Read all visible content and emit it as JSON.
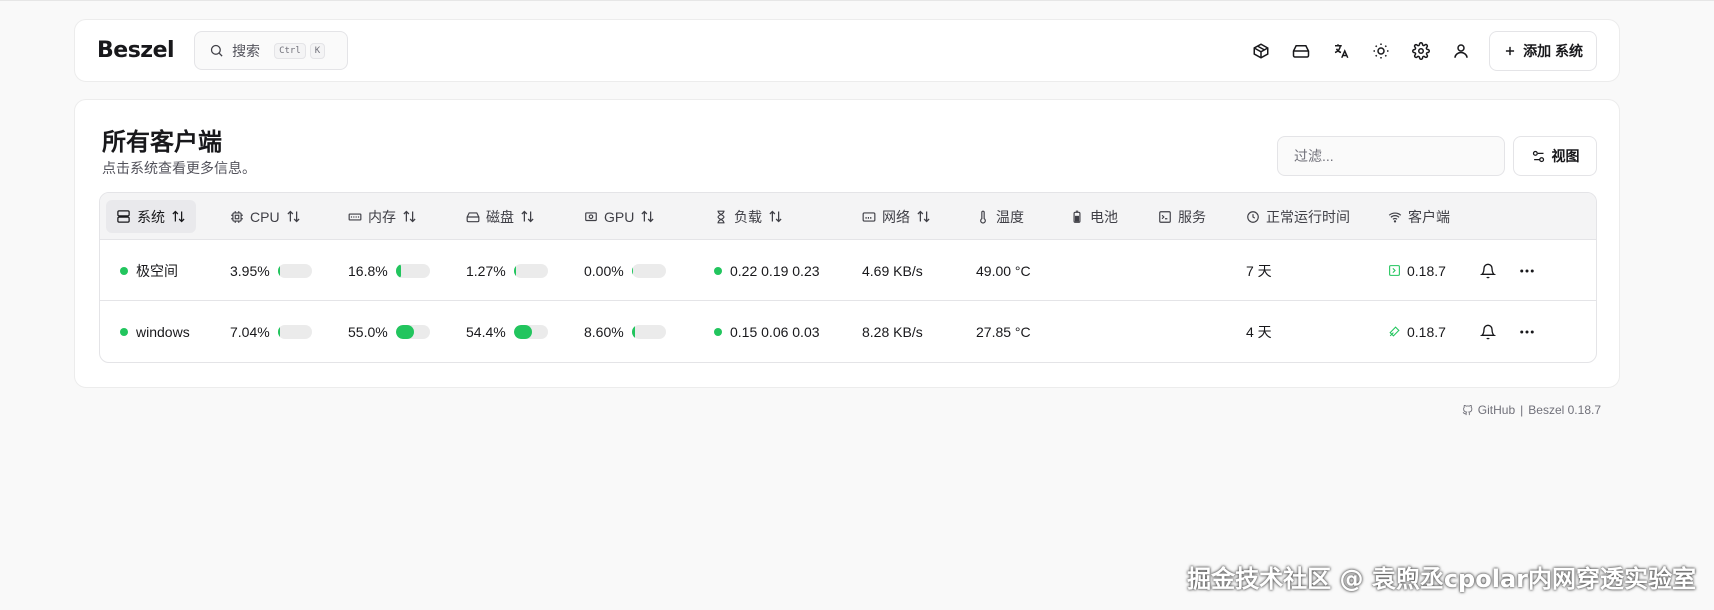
{
  "header": {
    "logo": "Beszel",
    "search_label": "搜索",
    "search_kbd": [
      "Ctrl",
      "K"
    ],
    "icons": [
      "container-icon",
      "hard-drive-icon",
      "language-icon",
      "theme-icon",
      "settings-icon",
      "user-icon"
    ],
    "add_label": "添加 系统"
  },
  "card": {
    "title": "所有客户端",
    "subtitle": "点击系统查看更多信息。",
    "filter_placeholder": "过滤...",
    "view_label": "视图"
  },
  "columns": {
    "system": "系统",
    "cpu": "CPU",
    "memory": "内存",
    "disk": "磁盘",
    "gpu": "GPU",
    "load": "负载",
    "network": "网络",
    "temperature": "温度",
    "battery": "电池",
    "services": "服务",
    "uptime": "正常运行时间",
    "agent": "客户端"
  },
  "rows": [
    {
      "name": "极空间",
      "status_color": "#22c55e",
      "cpu": "3.95%",
      "cpu_pct": 3.95,
      "memory": "16.8%",
      "memory_pct": 16.8,
      "disk": "1.27%",
      "disk_pct": 1.27,
      "gpu": "0.00%",
      "gpu_pct": 0,
      "load": "0.22 0.19 0.23",
      "network": "4.69 KB/s",
      "temperature": "49.00 °C",
      "battery": "",
      "services": "",
      "uptime": "7 天",
      "agent_version": "0.18.7",
      "agent_icon": "terminal-square-icon"
    },
    {
      "name": "windows",
      "status_color": "#22c55e",
      "cpu": "7.04%",
      "cpu_pct": 7.04,
      "memory": "55.0%",
      "memory_pct": 55.0,
      "disk": "54.4%",
      "disk_pct": 54.4,
      "gpu": "8.60%",
      "gpu_pct": 8.6,
      "load": "0.15 0.06 0.03",
      "network": "8.28 KB/s",
      "temperature": "27.85 °C",
      "battery": "",
      "services": "",
      "uptime": "4 天",
      "agent_version": "0.18.7",
      "agent_icon": "windows-agent-icon"
    }
  ],
  "footer": {
    "github": "GitHub",
    "separator": "|",
    "version": "Beszel 0.18.7"
  },
  "watermark": "掘金技术社区 @ 袁煦丞cpolar内网穿透实验室",
  "colors": {
    "status_up": "#22c55e",
    "bar_bg": "#ebebeb"
  }
}
